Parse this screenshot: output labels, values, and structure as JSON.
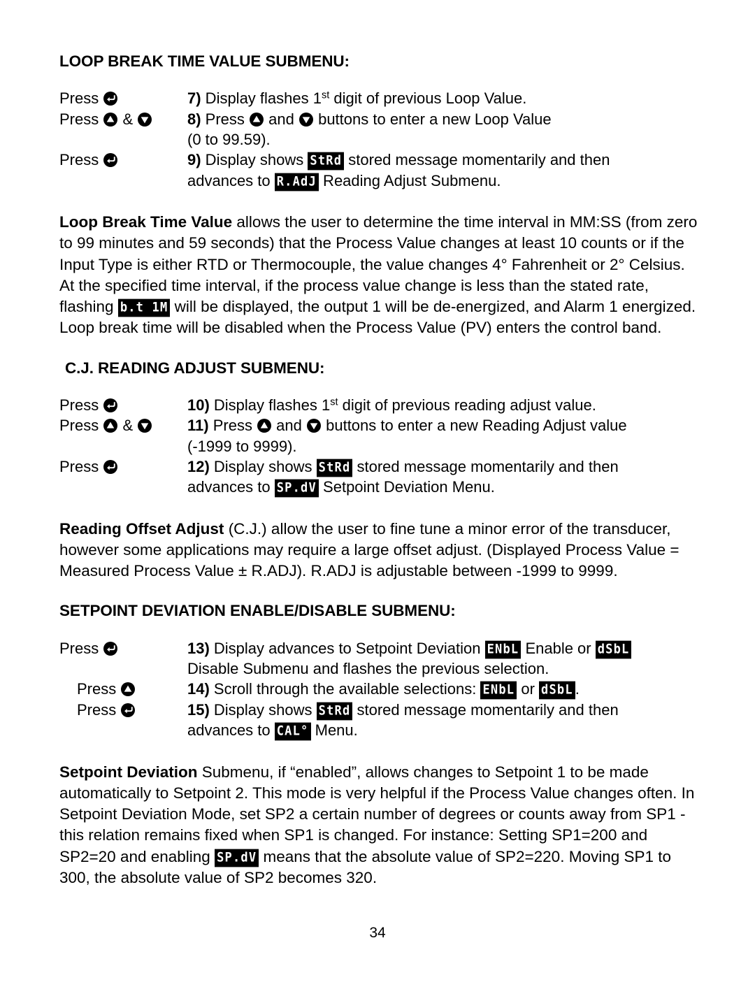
{
  "page": {
    "number": "34"
  },
  "icons": {
    "enter": "enter-button-icon",
    "up": "up-arrow-button-icon",
    "down": "down-arrow-button-icon"
  },
  "labels": {
    "press": "Press",
    "ampersand": "&"
  },
  "lcd": {
    "stored": "StRd",
    "reading_adjust": "R.AdJ",
    "loop_break_alarm": "b.t 1M",
    "setpoint_deviation": "SP.dV",
    "enable": "ENbL",
    "disable": "dSbL",
    "calibration": "CAL°"
  },
  "sections": [
    {
      "heading": "LOOP BREAK TIME VALUE SUBMENU:",
      "steps": [
        {
          "press": "Press",
          "buttons": [
            "enter"
          ],
          "number": "7)",
          "lines": [
            {
              "parts": [
                {
                  "t": "text",
                  "v": " Display flashes 1"
                },
                {
                  "t": "sup",
                  "v": "st"
                },
                {
                  "t": "text",
                  "v": " digit of previous Loop Value."
                }
              ]
            }
          ]
        },
        {
          "press": "Press",
          "buttons": [
            "up",
            "down"
          ],
          "number": "8)",
          "lines": [
            {
              "parts": [
                {
                  "t": "text",
                  "v": " Press "
                },
                {
                  "t": "icon",
                  "v": "up"
                },
                {
                  "t": "text",
                  "v": " and "
                },
                {
                  "t": "icon",
                  "v": "down"
                },
                {
                  "t": "text",
                  "v": " buttons to enter a new Loop Value"
                }
              ]
            },
            {
              "parts": [
                {
                  "t": "text",
                  "v": "(0 to 99.59)."
                }
              ]
            }
          ]
        },
        {
          "press": "Press",
          "buttons": [
            "enter"
          ],
          "number": "9)",
          "lines": [
            {
              "parts": [
                {
                  "t": "text",
                  "v": " Display shows "
                },
                {
                  "t": "lcd",
                  "v": "StRd"
                },
                {
                  "t": "text",
                  "v": " stored message momentarily and then"
                }
              ]
            },
            {
              "parts": [
                {
                  "t": "text",
                  "v": "advances to "
                },
                {
                  "t": "lcd",
                  "v": "R.AdJ"
                },
                {
                  "t": "text",
                  "v": " Reading Adjust Submenu."
                }
              ]
            }
          ]
        }
      ]
    },
    {
      "heading": "C.J. READING ADJUST SUBMENU:",
      "steps": [
        {
          "press": "Press",
          "buttons": [
            "enter"
          ],
          "number": "10)",
          "lines": [
            {
              "parts": [
                {
                  "t": "text",
                  "v": " Display flashes 1"
                },
                {
                  "t": "sup",
                  "v": "st"
                },
                {
                  "t": "text",
                  "v": " digit of previous reading adjust value."
                }
              ]
            }
          ]
        },
        {
          "press": "Press",
          "buttons": [
            "up",
            "down"
          ],
          "number": "11)",
          "lines": [
            {
              "parts": [
                {
                  "t": "text",
                  "v": " Press "
                },
                {
                  "t": "icon",
                  "v": "up"
                },
                {
                  "t": "text",
                  "v": " and "
                },
                {
                  "t": "icon",
                  "v": "down"
                },
                {
                  "t": "text",
                  "v": " buttons to enter a new Reading Adjust value"
                }
              ]
            },
            {
              "parts": [
                {
                  "t": "text",
                  "v": "(-1999 to 9999)."
                }
              ]
            }
          ]
        },
        {
          "press": "Press",
          "buttons": [
            "enter"
          ],
          "number": "12)",
          "lines": [
            {
              "parts": [
                {
                  "t": "text",
                  "v": " Display shows "
                },
                {
                  "t": "lcd",
                  "v": "StRd"
                },
                {
                  "t": "text",
                  "v": " stored message momentarily and then"
                }
              ]
            },
            {
              "parts": [
                {
                  "t": "text",
                  "v": "advances to "
                },
                {
                  "t": "lcd",
                  "v": "SP.dV"
                },
                {
                  "t": "text",
                  "v": " Setpoint Deviation Menu."
                }
              ]
            }
          ]
        }
      ]
    },
    {
      "heading": "SETPOINT DEVIATION ENABLE/DISABLE SUBMENU:",
      "steps": [
        {
          "press": "Press",
          "buttons": [
            "enter"
          ],
          "number": "13)",
          "lines": [
            {
              "parts": [
                {
                  "t": "text",
                  "v": " Display advances to Setpoint Deviation "
                },
                {
                  "t": "lcd",
                  "v": "ENbL"
                },
                {
                  "t": "text",
                  "v": " Enable or "
                },
                {
                  "t": "lcd",
                  "v": "dSbL"
                }
              ]
            },
            {
              "parts": [
                {
                  "t": "text",
                  "v": "Disable Submenu and flashes the previous selection."
                }
              ]
            }
          ]
        },
        {
          "press": "Press",
          "buttons": [
            "up"
          ],
          "number": "14)",
          "lines": [
            {
              "parts": [
                {
                  "t": "text",
                  "v": " Scroll through the available selections: "
                },
                {
                  "t": "lcd",
                  "v": "ENbL"
                },
                {
                  "t": "text",
                  "v": " or "
                },
                {
                  "t": "lcd",
                  "v": "dSbL"
                },
                {
                  "t": "text",
                  "v": "."
                }
              ]
            }
          ]
        },
        {
          "press": "Press",
          "buttons": [
            "enter"
          ],
          "number": "15)",
          "lines": [
            {
              "parts": [
                {
                  "t": "text",
                  "v": " Display shows "
                },
                {
                  "t": "lcd",
                  "v": "StRd"
                },
                {
                  "t": "text",
                  "v": " stored message momentarily and then"
                }
              ]
            },
            {
              "parts": [
                {
                  "t": "text",
                  "v": "advances to "
                },
                {
                  "t": "lcd",
                  "v": "CAL°"
                },
                {
                  "t": "text",
                  "v": " Menu."
                }
              ]
            }
          ]
        }
      ]
    }
  ],
  "paragraphs": [
    {
      "id": "loop-break-time-value",
      "parts": [
        {
          "t": "bold",
          "v": "Loop Break Time Value"
        },
        {
          "t": "text",
          "v": " allows the user to determine the time interval in MM:SS (from zero to 99 minutes and 59 seconds) that the Process Value changes at least 10 counts or if the Input Type is either RTD or Thermocouple, the value changes 4° Fahrenheit or 2° Celsius. At the specified time interval, if the process value change is less than the stated rate, flashing "
        },
        {
          "t": "lcd",
          "v": "b.t 1M"
        },
        {
          "t": "text",
          "v": " will be displayed, the output 1 will be de-energized, and Alarm 1 energized. Loop break time will be disabled when the Process Value (PV) enters the control band."
        }
      ]
    },
    {
      "id": "reading-offset-adjust",
      "parts": [
        {
          "t": "bold",
          "v": "Reading Offset Adjust"
        },
        {
          "t": "text",
          "v": " (C.J.) allow the user to fine tune a minor error of the transducer, however some applications may require a large offset adjust. (Displayed Process Value = Measured Process Value ± R.ADJ). R.ADJ is adjustable between -1999 to 9999."
        }
      ]
    },
    {
      "id": "setpoint-deviation",
      "parts": [
        {
          "t": "bold",
          "v": "Setpoint Deviation"
        },
        {
          "t": "text",
          "v": " Submenu, if “enabled”, allows changes to Setpoint 1 to be made automatically to Setpoint 2. This mode is very helpful if the Process Value changes often. In Setpoint Deviation Mode, set SP2 a certain number of degrees or counts away from SP1 - this relation remains fixed when SP1 is changed. For instance: Setting SP1=200 and SP2=20 and enabling "
        },
        {
          "t": "lcd",
          "v": "SP.dV"
        },
        {
          "t": "text",
          "v": " means that the absolute value of SP2=220. Moving SP1 to 300, the absolute value of SP2 becomes 320."
        }
      ]
    }
  ]
}
